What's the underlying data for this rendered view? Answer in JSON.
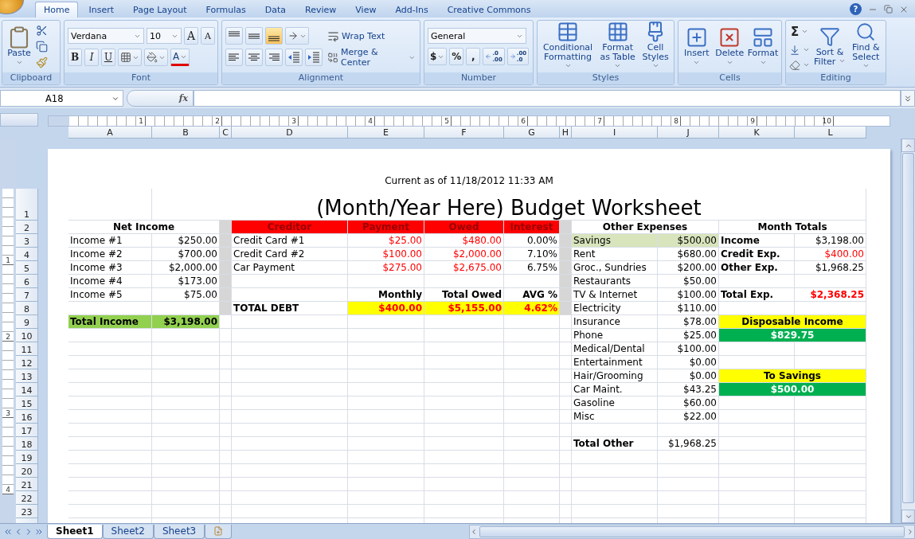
{
  "ribbon": {
    "tabs": [
      {
        "label": "Home",
        "selected": true
      },
      {
        "label": "Insert",
        "selected": false
      },
      {
        "label": "Page Layout",
        "selected": false
      },
      {
        "label": "Formulas",
        "selected": false
      },
      {
        "label": "Data",
        "selected": false
      },
      {
        "label": "Review",
        "selected": false
      },
      {
        "label": "View",
        "selected": false
      },
      {
        "label": "Add-Ins",
        "selected": false
      },
      {
        "label": "Creative Commons",
        "selected": false
      }
    ],
    "help": "?",
    "groups": [
      {
        "kind": "clipboard",
        "label": "Clipboard",
        "paste": "Paste"
      },
      {
        "kind": "font",
        "label": "Font",
        "font_name": "Verdana",
        "font_size": "10",
        "grow_shrink": [
          "A",
          "A"
        ],
        "style_buttons": [
          "B",
          "I",
          "U"
        ],
        "font_color": "A"
      },
      {
        "kind": "alignment",
        "label": "Alignment",
        "vertical_align": [
          {
            "kind": "top",
            "selected": false
          },
          {
            "kind": "middle",
            "selected": false
          },
          {
            "kind": "bottom",
            "selected": true
          }
        ],
        "wrap": "Wrap Text",
        "merge": "Merge & Center"
      },
      {
        "kind": "number",
        "label": "Number",
        "format": "General",
        "symbols": [
          "$",
          "%",
          ","
        ],
        "decimal_buttons": [
          [
            ".0",
            ".00"
          ],
          [
            ".00",
            ".0"
          ]
        ]
      },
      {
        "kind": "styles",
        "label": "Styles",
        "buttons": [
          "Conditional Formatting",
          "Format as Table",
          "Cell Styles"
        ]
      },
      {
        "kind": "cells",
        "label": "Cells",
        "buttons": [
          "Insert",
          "Delete",
          "Format"
        ]
      },
      {
        "kind": "editing",
        "label": "Editing",
        "sum": "Σ",
        "buttons": [
          "Sort & Filter",
          "Find & Select"
        ]
      }
    ]
  },
  "formula_bar": {
    "name_box": "A18",
    "fx": "fx"
  },
  "ruler": {
    "horizontal": [
      "1",
      "2",
      "3",
      "4",
      "5",
      "6",
      "7",
      "8",
      "9",
      "10"
    ],
    "vertical": [
      "1",
      "2",
      "3",
      "4"
    ]
  },
  "columns": [
    "A",
    "B",
    "C",
    "D",
    "E",
    "F",
    "G",
    "H",
    "I",
    "J",
    "K",
    "L"
  ],
  "row_numbers": [
    "1",
    "2",
    "3",
    "4",
    "5",
    "6",
    "7",
    "8",
    "9",
    "10",
    "11",
    "12",
    "13",
    "14",
    "15",
    "16",
    "17",
    "18",
    "19",
    "20",
    "21",
    "22",
    "23"
  ],
  "page": {
    "header": "Current as of 11/18/2012 11:33 AM",
    "title": "(Month/Year Here) Budget Worksheet",
    "net_income": {
      "heading": "Net Income",
      "rows": [
        {
          "label": "Income #1",
          "amount": "$250.00"
        },
        {
          "label": "Income #2",
          "amount": "$700.00"
        },
        {
          "label": "Income #3",
          "amount": "$2,000.00"
        },
        {
          "label": "Income #4",
          "amount": "$173.00"
        },
        {
          "label": "Income #5",
          "amount": "$75.00"
        }
      ],
      "total": {
        "label": "Total Income",
        "amount": "$3,198.00"
      }
    },
    "creditors": {
      "columns": [
        "Creditor",
        "Payment",
        "Owed",
        "Interest"
      ],
      "rows": [
        {
          "name": "Credit Card #1",
          "payment": "$25.00",
          "owed": "$480.00",
          "interest": "0.00%"
        },
        {
          "name": "Credit Card #2",
          "payment": "$100.00",
          "owed": "$2,000.00",
          "interest": "7.10%"
        },
        {
          "name": "Car Payment",
          "payment": "$275.00",
          "owed": "$2,675.00",
          "interest": "6.75%"
        }
      ],
      "summary_labels": [
        "Monthly",
        "Total Owed",
        "AVG %"
      ],
      "total": {
        "label": "TOTAL DEBT",
        "values": [
          "$400.00",
          "$5,155.00",
          "4.62%"
        ]
      }
    },
    "other_expenses": {
      "heading": "Other Expenses",
      "rows": [
        {
          "label": "Savings",
          "amount": "$500.00",
          "highlighted": true
        },
        {
          "label": "Rent",
          "amount": "$680.00",
          "highlighted": false
        },
        {
          "label": "Groc., Sundries",
          "amount": "$200.00",
          "highlighted": false
        },
        {
          "label": "Restaurants",
          "amount": "$50.00",
          "highlighted": false
        },
        {
          "label": "TV & Internet",
          "amount": "$100.00",
          "highlighted": false
        },
        {
          "label": "Electricity",
          "amount": "$110.00",
          "highlighted": false
        },
        {
          "label": "Insurance",
          "amount": "$78.00",
          "highlighted": false
        },
        {
          "label": "Phone",
          "amount": "$25.00",
          "highlighted": false
        },
        {
          "label": "Medical/Dental",
          "amount": "$100.00",
          "highlighted": false
        },
        {
          "label": "Entertainment",
          "amount": "$0.00",
          "highlighted": false
        },
        {
          "label": "Hair/Grooming",
          "amount": "$0.00",
          "highlighted": false
        },
        {
          "label": "Car Maint.",
          "amount": "$43.25",
          "highlighted": false
        },
        {
          "label": "Gasoline",
          "amount": "$60.00",
          "highlighted": false
        },
        {
          "label": "Misc",
          "amount": "$22.00",
          "highlighted": false
        }
      ],
      "total": {
        "label": "Total Other",
        "amount": "$1,968.25"
      }
    },
    "month_totals": {
      "heading": "Month Totals",
      "rows": [
        {
          "label": "Income",
          "amount": "$3,198.00",
          "kind": "plain"
        },
        {
          "label": "Credit Exp.",
          "amount": "$400.00",
          "kind": "debt"
        },
        {
          "label": "Other Exp.",
          "amount": "$1,968.25",
          "kind": "plain"
        }
      ],
      "total": {
        "label": "Total Exp.",
        "amount": "$2,368.25"
      },
      "disposable": {
        "label": "Disposable Income",
        "amount": "$829.75"
      },
      "to_savings": {
        "label": "To Savings",
        "amount": "$500.00"
      }
    }
  },
  "sheet_tabs": [
    {
      "label": "Sheet1",
      "selected": true
    },
    {
      "label": "Sheet2",
      "selected": false
    },
    {
      "label": "Sheet3",
      "selected": false
    }
  ]
}
